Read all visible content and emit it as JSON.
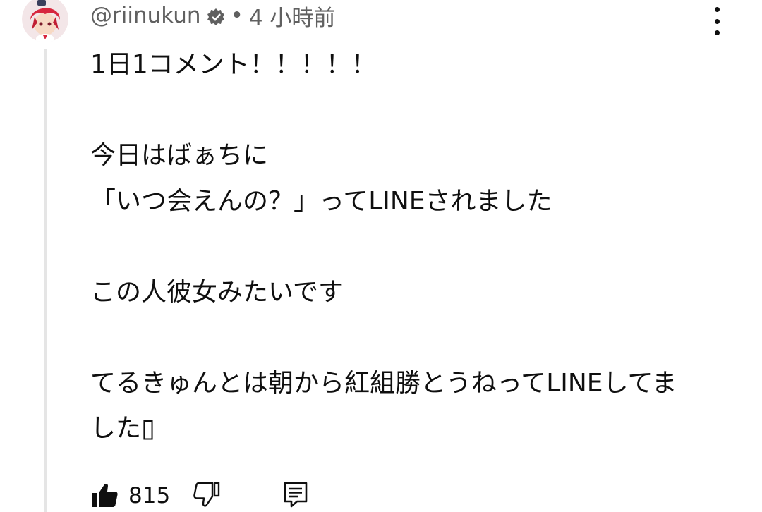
{
  "comment": {
    "author": "@riinukun",
    "time": "4 小時前",
    "separator": "•",
    "lines": [
      "1日1コメント！！！！！",
      "",
      "今日はばぁちに",
      "「いつ会えんの？」ってLINEされました",
      "",
      "この人彼女みたいです",
      "",
      "てるきゅんとは朝から紅組勝とうねってLINEしてま",
      "した▯"
    ],
    "likes": "815"
  },
  "icons": {
    "verified": "verified-badge-icon",
    "menu": "more-vert-icon",
    "like": "thumb-up-filled-icon",
    "dislike": "thumb-down-outline-icon",
    "reply": "reply-comment-icon"
  },
  "colors": {
    "text": "#0f0f0f",
    "meta": "#606060",
    "thread_line": "#e5e5e5",
    "avatar_hair": "#d7263d"
  }
}
